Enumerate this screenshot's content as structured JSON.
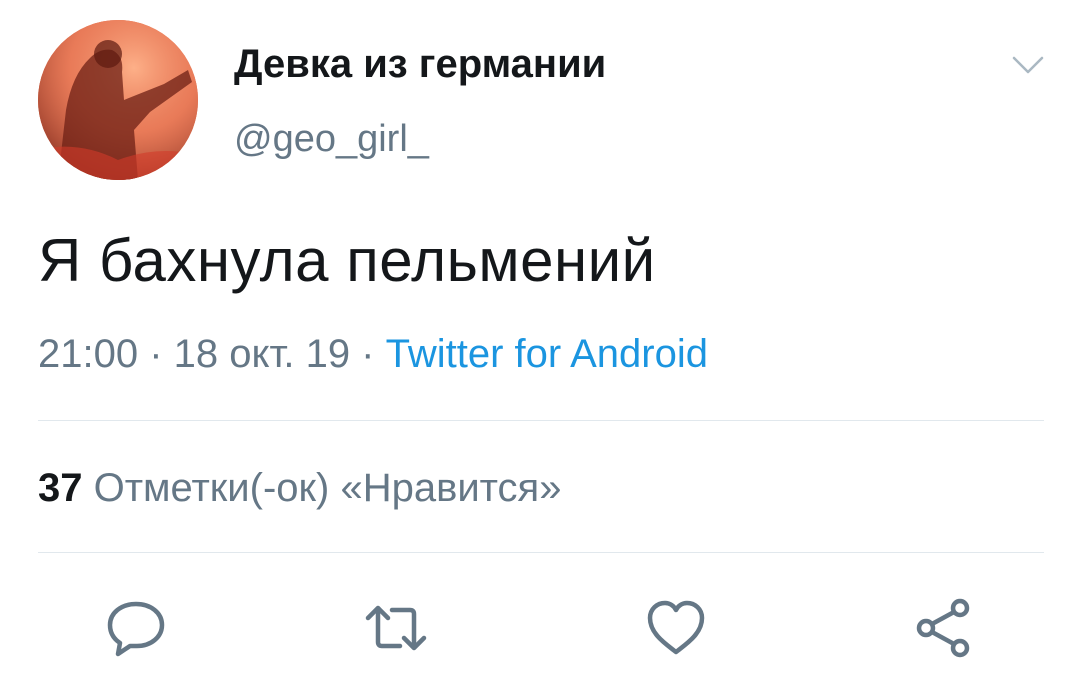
{
  "user": {
    "display_name": "Девка из германии",
    "handle": "@geo_girl_"
  },
  "tweet": {
    "text": "Я бахнула пельмений",
    "time": "21:00",
    "date": "18 окт. 19",
    "separator": " · ",
    "source": "Twitter for Android"
  },
  "stats": {
    "likes_count": "37",
    "likes_label": "Отметки(-ок) «Нравится»"
  },
  "icons": {
    "caret": "chevron-down-icon",
    "reply": "reply-icon",
    "retweet": "retweet-icon",
    "like": "heart-icon",
    "share": "share-icon"
  },
  "colors": {
    "text": "#14171a",
    "secondary": "#657786",
    "link": "#1b95e0",
    "divider": "#e1e8ed",
    "icon": "#657786"
  }
}
